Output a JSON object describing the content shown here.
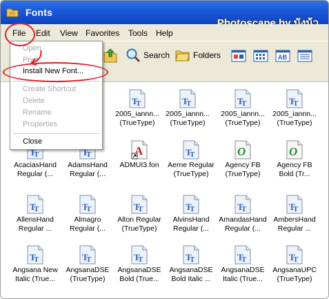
{
  "window": {
    "title": "Fonts",
    "watermark": "Photoscape by นังนุ้ว"
  },
  "menubar": {
    "items": [
      "File",
      "Edit",
      "View",
      "Favorites",
      "Tools",
      "Help"
    ]
  },
  "toolbar": {
    "search_label": "Search",
    "folders_label": "Folders"
  },
  "file_menu": {
    "items": [
      {
        "label": "Open",
        "enabled": false
      },
      {
        "label": "Print",
        "enabled": false
      },
      {
        "label": "Install New Font...",
        "enabled": true
      },
      {
        "label": "Create Shortcut",
        "enabled": false
      },
      {
        "label": "Delete",
        "enabled": false
      },
      {
        "label": "Rename",
        "enabled": false
      },
      {
        "label": "Properties",
        "enabled": false
      },
      {
        "label": "Close",
        "enabled": true
      }
    ]
  },
  "fonts": {
    "row1": [
      {
        "line1": "2005_iannn...",
        "line2": "(TrueType)",
        "icon": "truetype-font-icon"
      },
      {
        "line1": "2005_iannn...",
        "line2": "(TrueType)",
        "icon": "truetype-font-icon"
      },
      {
        "line1": "2005_iannn...",
        "line2": "(TrueType)",
        "icon": "truetype-font-icon"
      },
      {
        "line1": "2005_iannn...",
        "line2": "(TrueType)",
        "icon": "truetype-font-icon"
      }
    ],
    "row2": [
      {
        "line1": "AcaciasHand",
        "line2": "Regular (...",
        "icon": "truetype-font-icon"
      },
      {
        "line1": "AdamsHand",
        "line2": "Regular (...",
        "icon": "truetype-font-icon"
      },
      {
        "line1": "ADMUI3.fon",
        "line2": "",
        "icon": "raster-font-shortcut-icon"
      },
      {
        "line1": "Aerne Regular",
        "line2": "(TrueType)",
        "icon": "truetype-font-icon"
      },
      {
        "line1": "Agency FB",
        "line2": "(TrueType)",
        "icon": "opentype-font-icon"
      },
      {
        "line1": "Agency FB",
        "line2": "Bold (Tr...",
        "icon": "opentype-font-icon"
      }
    ],
    "row3": [
      {
        "line1": "AllensHand",
        "line2": "Regular ...",
        "icon": "truetype-font-icon"
      },
      {
        "line1": "Almagro",
        "line2": "Regular (...",
        "icon": "truetype-font-icon"
      },
      {
        "line1": "Alton Regular",
        "line2": "(TrueType)",
        "icon": "truetype-font-icon"
      },
      {
        "line1": "AlvinsHand",
        "line2": "Regular (...",
        "icon": "truetype-font-icon"
      },
      {
        "line1": "AmandasHand",
        "line2": "Regular (...",
        "icon": "truetype-font-icon"
      },
      {
        "line1": "AmbersHand",
        "line2": "Regular ...",
        "icon": "truetype-font-icon"
      }
    ],
    "row4": [
      {
        "line1": "Angsana New",
        "line2": "Italic (True...",
        "icon": "truetype-font-icon"
      },
      {
        "line1": "AngsanaDSE",
        "line2": "(TrueType)",
        "icon": "truetype-font-icon"
      },
      {
        "line1": "AngsanaDSE",
        "line2": "Bold (True...",
        "icon": "truetype-font-icon"
      },
      {
        "line1": "AngsanaDSE",
        "line2": "Bold Italic ...",
        "icon": "truetype-font-icon"
      },
      {
        "line1": "AngsanaDSE",
        "line2": "Italic (True...",
        "icon": "truetype-font-icon"
      },
      {
        "line1": "AngsanaUPC",
        "line2": "(TrueType)",
        "icon": "truetype-font-icon"
      }
    ]
  },
  "colors": {
    "titlebar": "#1a57d6",
    "annotation": "#e11d26",
    "menu_bg": "#ece9d8"
  }
}
